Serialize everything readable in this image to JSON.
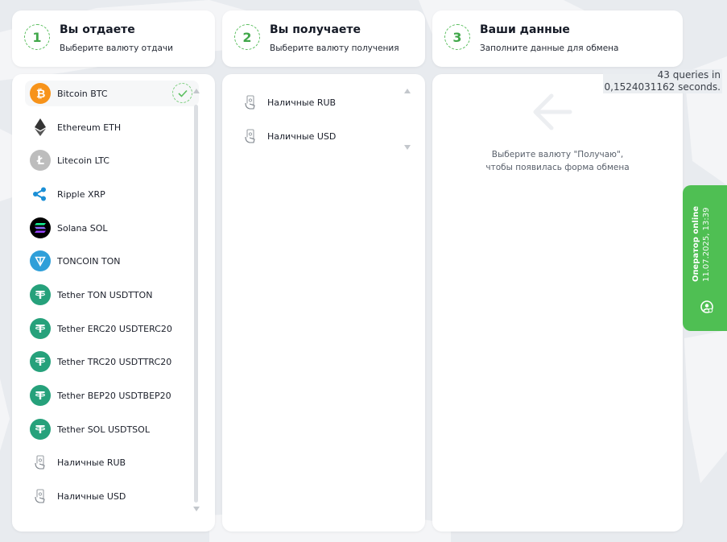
{
  "steps": [
    {
      "num": "1",
      "title": "Вы отдаете",
      "subtitle": "Выберите валюту отдачи"
    },
    {
      "num": "2",
      "title": "Вы получаете",
      "subtitle": "Выберите валюту получения"
    },
    {
      "num": "3",
      "title": "Ваши данные",
      "subtitle": "Заполните данные для обмена"
    }
  ],
  "give_list": [
    {
      "label": "Bitcoin BTC",
      "icon": "bitcoin-icon",
      "selected": true
    },
    {
      "label": "Ethereum ETH",
      "icon": "ethereum-icon"
    },
    {
      "label": "Litecoin LTC",
      "icon": "litecoin-icon"
    },
    {
      "label": "Ripple XRP",
      "icon": "ripple-icon"
    },
    {
      "label": "Solana SOL",
      "icon": "solana-icon"
    },
    {
      "label": "TONCOIN TON",
      "icon": "toncoin-icon"
    },
    {
      "label": "Tether TON USDTTON",
      "icon": "tether-icon"
    },
    {
      "label": "Tether ERC20 USDTERC20",
      "icon": "tether-icon"
    },
    {
      "label": "Tether TRC20 USDTTRC20",
      "icon": "tether-icon"
    },
    {
      "label": "Tether BEP20 USDTBEP20",
      "icon": "tether-icon"
    },
    {
      "label": "Tether SOL USDTSOL",
      "icon": "tether-icon"
    },
    {
      "label": "Наличные RUB",
      "icon": "cash-hand-icon"
    },
    {
      "label": "Наличные USD",
      "icon": "cash-hand-icon"
    }
  ],
  "get_list": [
    {
      "label": "Наличные RUB",
      "icon": "cash-hand-icon"
    },
    {
      "label": "Наличные USD",
      "icon": "cash-hand-icon"
    }
  ],
  "details": {
    "hint_line1": "Выберите валюту \"Получаю\",",
    "hint_line2": "чтобы появилась форма обмена"
  },
  "queries": {
    "line1": "43 queries in",
    "line2": "0,1524031162 seconds."
  },
  "operator": {
    "status": "Оператор online",
    "datetime": "11.07.2025, 13:39"
  },
  "colors": {
    "accent_green": "#4fbf53",
    "bitcoin": "#f7931a",
    "tether": "#26a17b",
    "toncoin": "#2f9fd9",
    "ripple": "#1b8fd6",
    "litecoin": "#bdbdbd"
  }
}
